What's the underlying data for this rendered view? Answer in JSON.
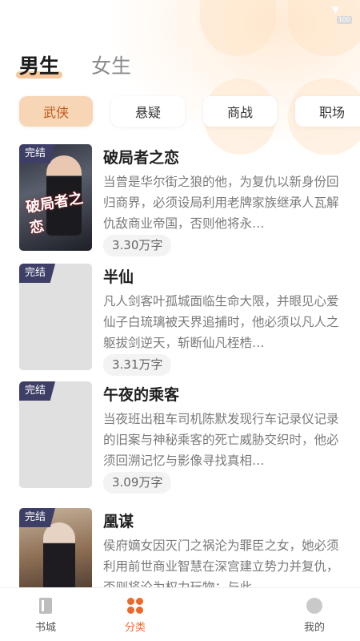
{
  "gender_tabs": [
    {
      "label": "男生",
      "active": true
    },
    {
      "label": "女生",
      "active": false
    }
  ],
  "categories": [
    {
      "label": "武侠",
      "active": true
    },
    {
      "label": "悬疑",
      "active": false
    },
    {
      "label": "商战",
      "active": false
    },
    {
      "label": "职场",
      "active": false
    }
  ],
  "books": [
    {
      "badge": "完结",
      "cover_text": "破局者之恋",
      "title": "破局者之恋",
      "description": "当曾是华尔街之狼的他，为复仇以新身份回归商界，必须设局利用老牌家族继承人瓦解仇敌商业帝国，否则他将永…",
      "word_count": "3.30万字"
    },
    {
      "badge": "完结",
      "title": "半仙",
      "description": "凡人剑客叶孤城面临生命大限，并眼见心爱仙子白琉璃被天界追捕时，他必须以凡人之躯拔剑逆天，斩断仙凡桎梏…",
      "word_count": "3.31万字"
    },
    {
      "badge": "完结",
      "title": "午夜的乘客",
      "description": "当夜班出租车司机陈默发现行车记录仪记录的旧案与神秘乘客的死亡威胁交织时，他必须回溯记忆与影像寻找真相…",
      "word_count": "3.09万字"
    },
    {
      "badge": "完结",
      "title": "凰谋",
      "description": "侯府嫡女因灭门之祸沦为罪臣之女，她必须利用前世商业智慧在深宫建立势力并复仇，否则将沦为权力玩物；与此…",
      "word_count": ""
    }
  ],
  "bottom_nav": [
    {
      "label": "书城",
      "active": false,
      "icon": "book-icon"
    },
    {
      "label": "分类",
      "active": true,
      "icon": "category-icon"
    },
    {
      "label": "我的",
      "active": false,
      "icon": "profile-icon"
    }
  ],
  "status_bar": {
    "battery": "100"
  },
  "colors": {
    "accent": "#ea6a2c",
    "chip_active_bg": "#f7d6b6",
    "badge_bg": "#3d3f66",
    "tab_underline": "#f6c89b"
  }
}
